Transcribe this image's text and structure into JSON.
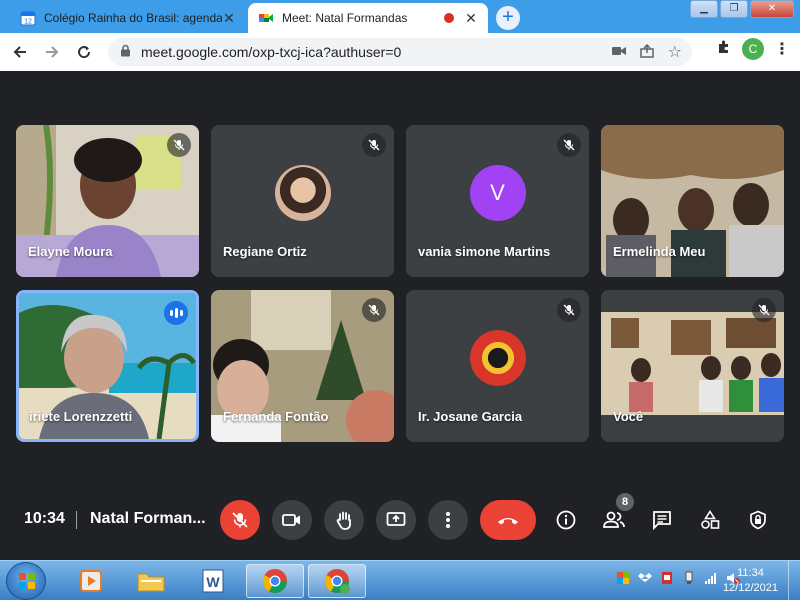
{
  "browser": {
    "tabs": [
      {
        "label": "Colégio Rainha do Brasil: agenda",
        "favicon_text": "12",
        "active": false
      },
      {
        "label": "Meet: Natal Formandas",
        "active": true,
        "recording": true
      }
    ],
    "url": "meet.google.com/oxp-txcj-ica?authuser=0",
    "profile_initial": "C"
  },
  "participants": [
    {
      "name": "Elayne Moura",
      "muted": true
    },
    {
      "name": "Regiane Ortiz",
      "muted": true
    },
    {
      "name": "vania simone Martins",
      "muted": true,
      "avatar_letter": "V",
      "avatar_color": "#a142f4"
    },
    {
      "name": "Ermelinda Meu",
      "muted": false
    },
    {
      "name": "iriete Lorenzzetti",
      "muted": false,
      "speaking": true
    },
    {
      "name": "Fernanda Fontão",
      "muted": true
    },
    {
      "name": "Ir. Josane Garcia",
      "muted": true
    },
    {
      "name": "Você",
      "muted": true
    }
  ],
  "meeting": {
    "time": "10:34",
    "name": "Natal Forman...",
    "participant_count": "8"
  },
  "controls": {
    "mic": "mic-off-icon",
    "camera": "camera-icon",
    "hand": "raise-hand-icon",
    "present": "present-screen-icon",
    "more": "more-vert-icon",
    "hangup": "hangup-icon",
    "info": "info-icon",
    "people": "people-icon",
    "chat": "chat-icon",
    "activities": "activities-icon",
    "host": "host-controls-icon"
  },
  "taskbar": {
    "time": "11:34",
    "date": "12/12/2021"
  },
  "colors": {
    "meet_bg": "#202124",
    "tile_bg": "#3c4043",
    "danger": "#ea4335",
    "speaking": "#1a73e8"
  }
}
